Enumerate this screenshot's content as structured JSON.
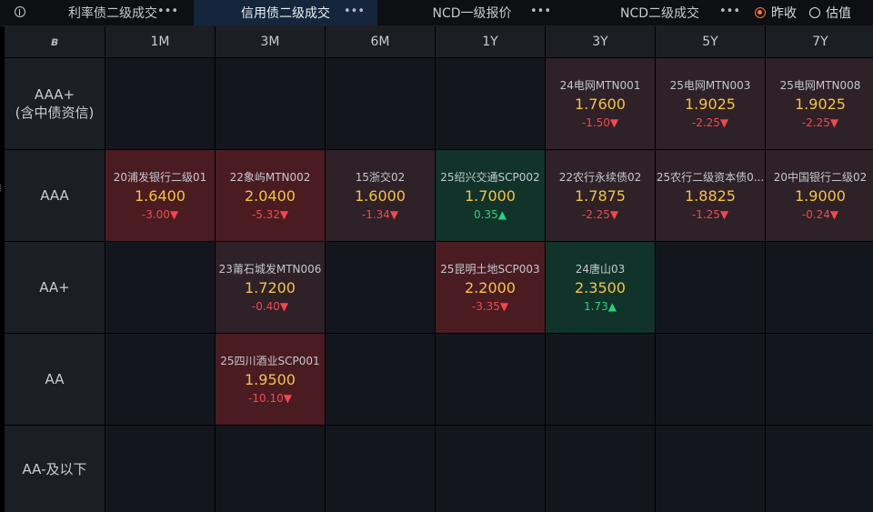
{
  "tabs": [
    {
      "label": "利率债二级成交",
      "more": "•••",
      "active": false
    },
    {
      "label": "信用债二级成交",
      "more": "•••",
      "active": true
    },
    {
      "label": "NCD一级报价",
      "more": "•••",
      "active": false
    },
    {
      "label": "NCD二级成交",
      "more": "•••",
      "active": false
    }
  ],
  "toggle": {
    "options": [
      "昨收",
      "估值"
    ],
    "selected": "昨收"
  },
  "columns": [
    "1M",
    "3M",
    "6M",
    "1Y",
    "3Y",
    "5Y",
    "7Y"
  ],
  "rows": [
    {
      "rating": "AAA+",
      "rating_note": "(含中债资信)",
      "cells": [
        null,
        null,
        null,
        null,
        {
          "name": "24电网MTN001",
          "price": "1.7600",
          "change": "-1.50▼",
          "direction": "down",
          "shade": "light"
        },
        {
          "name": "25电网MTN003",
          "price": "1.9025",
          "change": "-2.25▼",
          "direction": "down",
          "shade": "light"
        },
        {
          "name": "25电网MTN008",
          "price": "1.9025",
          "change": "-2.25▼",
          "direction": "down",
          "shade": "light"
        }
      ]
    },
    {
      "rating": "AAA",
      "rating_note": "",
      "cells": [
        {
          "name": "20浦发银行二级01",
          "price": "1.6400",
          "change": "-3.00▼",
          "direction": "down",
          "shade": "dark"
        },
        {
          "name": "22象屿MTN002",
          "price": "2.0400",
          "change": "-5.32▼",
          "direction": "down",
          "shade": "dark"
        },
        {
          "name": "15浙交02",
          "price": "1.6000",
          "change": "-1.34▼",
          "direction": "down",
          "shade": "light"
        },
        {
          "name": "25绍兴交通SCP002",
          "price": "1.7000",
          "change": "0.35▲",
          "direction": "up",
          "shade": "green"
        },
        {
          "name": "22农行永续债02",
          "price": "1.7875",
          "change": "-2.25▼",
          "direction": "down",
          "shade": "light"
        },
        {
          "name": "25农行二级资本债0...",
          "price": "1.8825",
          "change": "-1.25▼",
          "direction": "down",
          "shade": "light"
        },
        {
          "name": "20中国银行二级02",
          "price": "1.9000",
          "change": "-0.24▼",
          "direction": "down",
          "shade": "light"
        }
      ]
    },
    {
      "rating": "AA+",
      "rating_note": "",
      "cells": [
        null,
        {
          "name": "23莆石城发MTN006",
          "price": "1.7200",
          "change": "-0.40▼",
          "direction": "down",
          "shade": "light"
        },
        null,
        {
          "name": "25昆明土地SCP003",
          "price": "2.2000",
          "change": "-3.35▼",
          "direction": "down",
          "shade": "dark"
        },
        {
          "name": "24唐山03",
          "price": "2.3500",
          "change": "1.73▲",
          "direction": "up",
          "shade": "green"
        },
        null,
        null
      ]
    },
    {
      "rating": "AA",
      "rating_note": "",
      "cells": [
        null,
        {
          "name": "25四川酒业SCP001",
          "price": "1.9500",
          "change": "-10.10▼",
          "direction": "down",
          "shade": "dark"
        },
        null,
        null,
        null,
        null,
        null
      ]
    },
    {
      "rating": "AA-及以下",
      "rating_note": "",
      "cells": [
        null,
        null,
        null,
        null,
        null,
        null,
        null
      ]
    }
  ]
}
